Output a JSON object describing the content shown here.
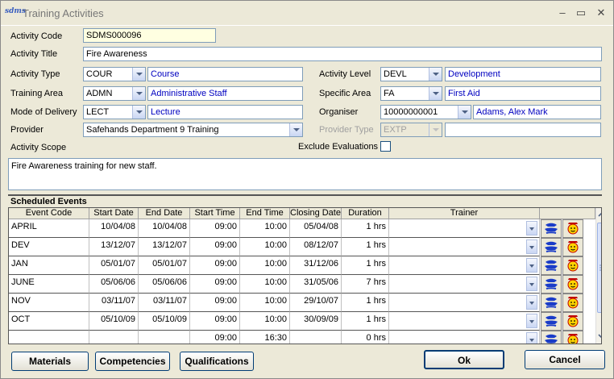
{
  "window": {
    "title": "Training Activities",
    "app_icon_text": "sdms"
  },
  "labels": {
    "activity_code": "Activity Code",
    "activity_title": "Activity Title",
    "activity_type": "Activity Type",
    "training_area": "Training Area",
    "mode_of_delivery": "Mode of Delivery",
    "provider": "Provider",
    "activity_scope": "Activity Scope",
    "activity_level": "Activity Level",
    "specific_area": "Specific Area",
    "organiser": "Organiser",
    "provider_type": "Provider Type",
    "exclude_evaluations": "Exclude Evaluations"
  },
  "fields": {
    "activity_code": "SDMS000096",
    "activity_title": "Fire Awareness",
    "activity_type_code": "COUR",
    "activity_type_desc": "Course",
    "training_area_code": "ADMN",
    "training_area_desc": "Administrative Staff",
    "mode_of_delivery_code": "LECT",
    "mode_of_delivery_desc": "Lecture",
    "provider": "Safehands Department 9 Training",
    "activity_level_code": "DEVL",
    "activity_level_desc": "Development",
    "specific_area_code": "FA",
    "specific_area_desc": "First Aid",
    "organiser_code": "10000000001",
    "organiser_desc": "Adams, Alex Mark",
    "provider_type_code": "EXTP",
    "provider_type_desc": "",
    "exclude_evaluations": false,
    "activity_scope": "Fire Awareness training for new staff."
  },
  "events": {
    "title": "Scheduled Events",
    "columns": [
      "Event Code",
      "Start Date",
      "End Date",
      "Start Time",
      "End Time",
      "Closing Date",
      "Duration",
      "Trainer"
    ],
    "rows": [
      [
        "APRIL",
        "10/04/08",
        "10/04/08",
        "09:00",
        "10:00",
        "05/04/08",
        "1 hrs",
        ""
      ],
      [
        "DEV",
        "13/12/07",
        "13/12/07",
        "09:00",
        "10:00",
        "08/12/07",
        "1 hrs",
        ""
      ],
      [
        "JAN",
        "05/01/07",
        "05/01/07",
        "09:00",
        "10:00",
        "31/12/06",
        "1 hrs",
        ""
      ],
      [
        "JUNE",
        "05/06/06",
        "05/06/06",
        "09:00",
        "10:00",
        "31/05/06",
        "7 hrs",
        ""
      ],
      [
        "NOV",
        "03/11/07",
        "03/11/07",
        "09:00",
        "10:00",
        "29/10/07",
        "1 hrs",
        ""
      ],
      [
        "OCT",
        "05/10/09",
        "05/10/09",
        "09:00",
        "10:00",
        "30/09/09",
        "1 hrs",
        ""
      ],
      [
        "",
        "",
        "",
        "09:00",
        "16:30",
        "",
        "0 hrs",
        ""
      ]
    ],
    "row_icons": [
      "trainer-lookup-icon",
      "smiley-face-icon"
    ]
  },
  "buttons": {
    "materials": "Materials",
    "competencies": "Competencies",
    "qualifications": "Qualifications",
    "ok": "Ok",
    "cancel": "Cancel"
  },
  "colors": {
    "desc_text": "#0000c0",
    "code_field_bg": "#ffffe1",
    "window_bg": "#ece9d8"
  }
}
